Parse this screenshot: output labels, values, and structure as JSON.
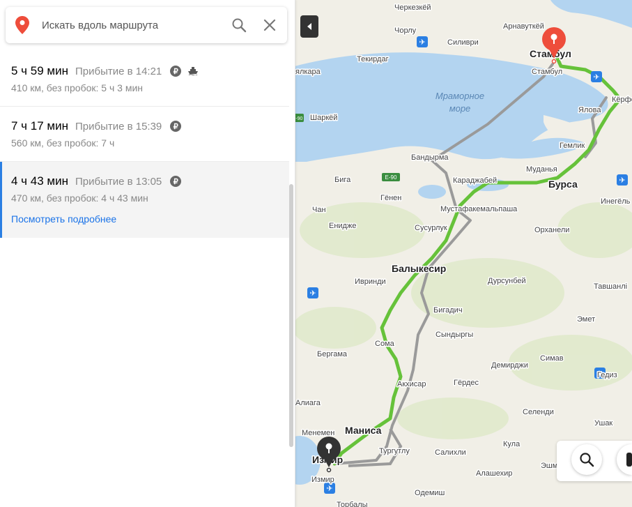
{
  "search": {
    "placeholder": "Искать вдоль маршрута"
  },
  "routes": [
    {
      "duration": "5 ч 59 мин",
      "arrival": "Прибытие в 14:21",
      "distance": "410 км, без пробок: 5 ч 3 мин",
      "toll": "₽",
      "ferry": true
    },
    {
      "duration": "7 ч 17 мин",
      "arrival": "Прибытие в 15:39",
      "distance": "560 км, без пробок: 7 ч",
      "toll": "₽"
    },
    {
      "duration": "4 ч 43 мин",
      "arrival": "Прибытие в 13:05",
      "distance": "470 км, без пробок: 4 ч 43 мин",
      "toll": "₽",
      "details_link": "Посмотреть подробнее",
      "selected": true
    }
  ],
  "map": {
    "sea_label": [
      "Мраморное",
      "море"
    ],
    "highways": [
      "E-90",
      "E-90"
    ],
    "cities": {
      "istanbul": "Стамбул",
      "istanbul_marker": "Стамбул",
      "izmir": "Измир",
      "izmir_marker": "Измир",
      "bursa": "Бурса",
      "balikesir": "Балыкесир",
      "manisa": "Маниса",
      "bandirma": "Бандырма",
      "tekirdag": "Текирдаг",
      "cherkezkoy": "Черкезкёй",
      "chorlu": "Чорлу",
      "silivri": "Силиври",
      "arnavutkoy": "Арнавуткёй",
      "sharkoy": "Шаркёй",
      "malkara": "ялкара",
      "biga": "Бига",
      "genen": "Гёнен",
      "chan": "Чан",
      "enidzhe": "Енидже",
      "karadzhabei": "Караджабей",
      "mudanya": "Муданья",
      "gemlik": "Гемлик",
      "yalova": "Ялова",
      "mustafakemalpasha": "Мустафакемальпаша",
      "susurluk": "Сусурлук",
      "orhaneli": "Орханели",
      "inegol": "Инегёль",
      "ivrindi": "Ивринди",
      "dursunbey": "Дурсунбей",
      "tavshanly": "Тавшанлі",
      "bigadich": "Бигадич",
      "emet": "Эмет",
      "sindirgy": "Сындыргы",
      "soma": "Сома",
      "bergama": "Бергама",
      "demirdzhi": "Демирджи",
      "simav": "Симав",
      "gediz": "Гедиз",
      "akhisar": "Акхисар",
      "gerdes": "Гёрдес",
      "aliaga": "Алиага",
      "selendi": "Селенди",
      "ushak": "Ушак",
      "kula": "Кула",
      "menemen": "Менемен",
      "turgutlu": "Тургутлу",
      "salihli": "Салихли",
      "alashehir": "Алашехир",
      "eshme": "Эшме",
      "odemish": "Одемиш",
      "torbaly": "Торбалы",
      "kerpe": "Кёрфе"
    }
  },
  "colors": {
    "route_main": "#66c23a",
    "route_alt": "#9a9a9a",
    "water": "#b3d4f0",
    "land": "#f1efe7",
    "marker_end": "#ee4d3b",
    "marker_start": "#333333",
    "link": "#1a73e8"
  },
  "icons": {
    "location": "location-pin-icon",
    "search": "search-icon",
    "close": "close-icon",
    "toll": "ruble-icon",
    "ferry": "ferry-icon",
    "collapse": "chevron-left-icon",
    "airport": "airport-icon"
  }
}
